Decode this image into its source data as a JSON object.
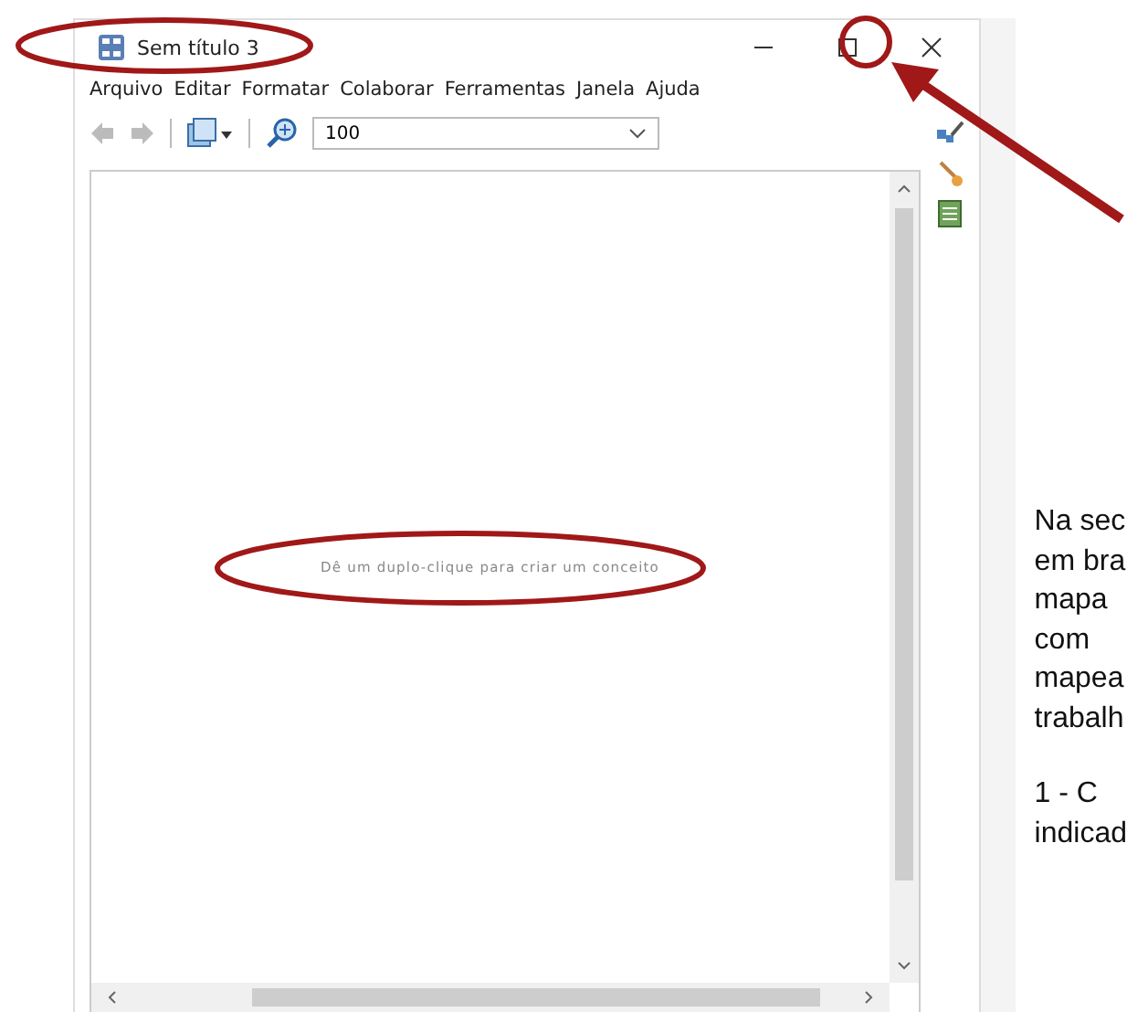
{
  "window": {
    "title": "Sem título 3"
  },
  "menu": [
    "Arquivo",
    "Editar",
    "Formatar",
    "Colaborar",
    "Ferramentas",
    "Janela",
    "Ajuda"
  ],
  "toolbar": {
    "back_disabled": true,
    "forward_disabled": true,
    "zoom": "100"
  },
  "canvas": {
    "hint": "Dê um duplo-clique para criar um conceito"
  },
  "side_text": {
    "paragraphs": [
      [
        "Na sec",
        "em bra",
        "mapa",
        "com",
        "mapea",
        "trabalh"
      ],
      [
        "1 - C",
        "indicad"
      ]
    ]
  }
}
